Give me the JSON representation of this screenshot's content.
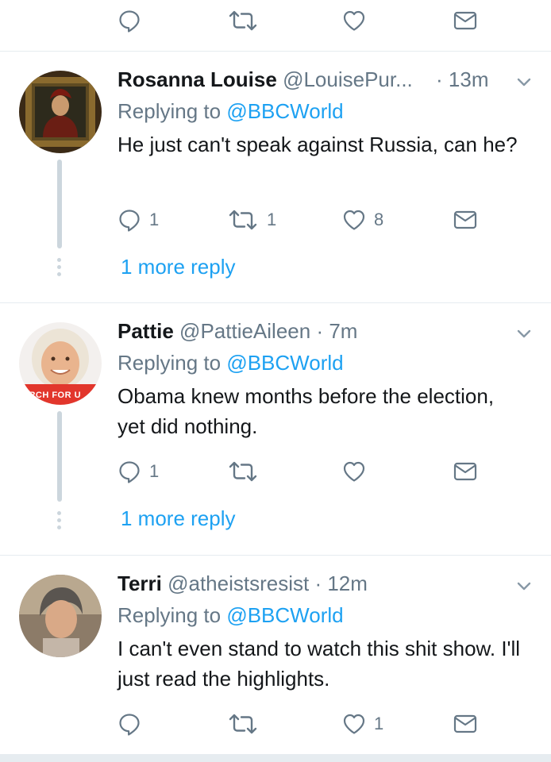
{
  "top_actions": {
    "reply_count": "",
    "retweet_count": "",
    "like_count": ""
  },
  "tweets": [
    {
      "name": "Rosanna Louise",
      "handle": "@LouisePur...",
      "time": "· 13m",
      "replying_prefix": "Replying to",
      "replying_to": "@BBCWorld",
      "text": "He just can't speak against Russia, can he?",
      "reply_count": "1",
      "retweet_count": "1",
      "like_count": "8",
      "more_reply": "1 more reply"
    },
    {
      "name": "Pattie",
      "handle": "@PattieAileen",
      "time": "· 7m",
      "replying_prefix": "Replying to",
      "replying_to": "@BBCWorld",
      "text": "Obama knew months before the election, yet did nothing.",
      "reply_count": "1",
      "retweet_count": "",
      "like_count": "",
      "more_reply": "1 more reply",
      "avatar_text": "ARCH FOR U"
    },
    {
      "name": "Terri",
      "handle": "@atheistsresist",
      "time": "· 12m",
      "replying_prefix": "Replying to",
      "replying_to": "@BBCWorld",
      "text": "I can't even stand to watch this shit show. I'll just read the highlights.",
      "reply_count": "",
      "retweet_count": "",
      "like_count": "1"
    }
  ],
  "colors": {
    "link": "#1da1f2",
    "muted": "#657786",
    "divider": "#e6ecf0"
  },
  "icons": [
    "reply-icon",
    "retweet-icon",
    "like-icon",
    "direct-message-icon",
    "chevron-down-icon"
  ]
}
